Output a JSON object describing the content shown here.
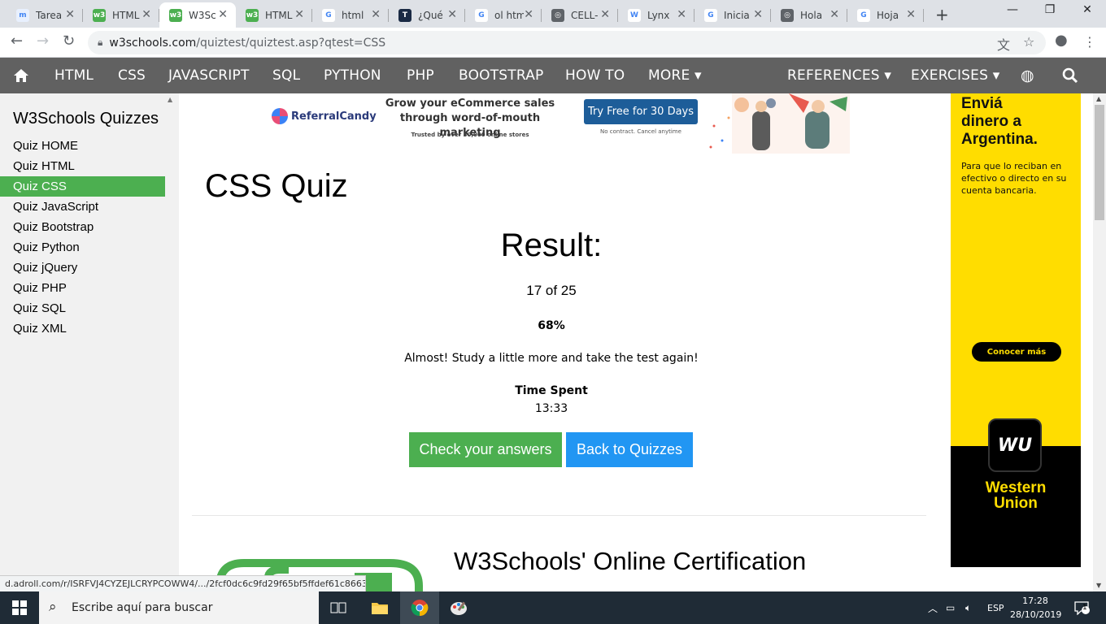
{
  "browser": {
    "tabs": [
      {
        "label": "Tarea",
        "favicon_color": "#e8f0fe",
        "favicon_text": "m"
      },
      {
        "label": "HTML",
        "favicon_color": "#4caf50",
        "favicon_text": "w3"
      },
      {
        "label": "W3Sc",
        "favicon_color": "#4caf50",
        "favicon_text": "w3",
        "active": true
      },
      {
        "label": "HTML",
        "favicon_color": "#4caf50",
        "favicon_text": "w3"
      },
      {
        "label": "html",
        "favicon_color": "#ffffff",
        "favicon_text": "G"
      },
      {
        "label": "¿Qué",
        "favicon_color": "#1a2a44",
        "favicon_text": "T"
      },
      {
        "label": "ol htm",
        "favicon_color": "#ffffff",
        "favicon_text": "G"
      },
      {
        "label": "CELL-",
        "favicon_color": "#5f6368",
        "favicon_text": "◎"
      },
      {
        "label": "Lynx",
        "favicon_color": "#ffffff",
        "favicon_text": "W"
      },
      {
        "label": "Inicia",
        "favicon_color": "#ffffff",
        "favicon_text": "G"
      },
      {
        "label": "Hola",
        "favicon_color": "#5f6368",
        "favicon_text": "◎"
      },
      {
        "label": "Hoja",
        "favicon_color": "#ffffff",
        "favicon_text": "G"
      }
    ],
    "url_host": "w3schools.com",
    "url_path": "/quiztest/quiztest.asp?qtest=CSS"
  },
  "nav": {
    "items": [
      "HTML",
      "CSS",
      "JAVASCRIPT",
      "SQL",
      "PYTHON",
      "PHP",
      "BOOTSTRAP",
      "HOW TO",
      "MORE ▾"
    ],
    "right_items": [
      "REFERENCES ▾",
      "EXERCISES ▾"
    ]
  },
  "sidebar": {
    "title": "W3Schools Quizzes",
    "items": [
      "Quiz HOME",
      "Quiz HTML",
      "Quiz CSS",
      "Quiz JavaScript",
      "Quiz Bootstrap",
      "Quiz Python",
      "Quiz jQuery",
      "Quiz PHP",
      "Quiz SQL",
      "Quiz XML"
    ],
    "active_index": 2
  },
  "ad_top": {
    "brand": "ReferralCandy",
    "headline_1": "Grow your eCommerce sales",
    "headline_2": "through word-of-mouth marketing",
    "trusted": "Trusted by over 30,000 online stores",
    "cta": "Try Free for 30 Days",
    "note": "No contract. Cancel anytime"
  },
  "quiz": {
    "title": "CSS Quiz",
    "result_label": "Result:",
    "score": "17 of 25",
    "percent": "68%",
    "progress_fraction": 0.68,
    "message": "Almost! Study a little more and take the test again!",
    "time_label": "Time Spent",
    "time_value": "13:33",
    "check_button": "Check your answers",
    "back_button": "Back to Quizzes"
  },
  "certification": {
    "title": "W3Schools' Online Certification"
  },
  "ad_right": {
    "headline_1": "Enviá",
    "headline_2": "dinero a",
    "headline_3": "Argentina.",
    "sub": "Para que lo reciban en efectivo o directo en su cuenta bancaria.",
    "cta": "Conocer más",
    "badge": "WU",
    "brand_1": "Western",
    "brand_2": "Union"
  },
  "status_url": "d.adroll.com/r/ISRFVJ4CYZEJLCRYPCOWW4/.../2fcf0dc6c9fd29f65bf5ffdef61c8663...",
  "taskbar": {
    "search_placeholder": "Escribe aquí para buscar",
    "language": "ESP",
    "time": "17:28",
    "date": "28/10/2019",
    "notifications": "1"
  },
  "colors": {
    "nav_bg": "#616161",
    "sidebar_active": "#4caf50",
    "check_button": "#4caf50",
    "back_button": "#2196f3",
    "wu_yellow": "#ffdd00"
  }
}
